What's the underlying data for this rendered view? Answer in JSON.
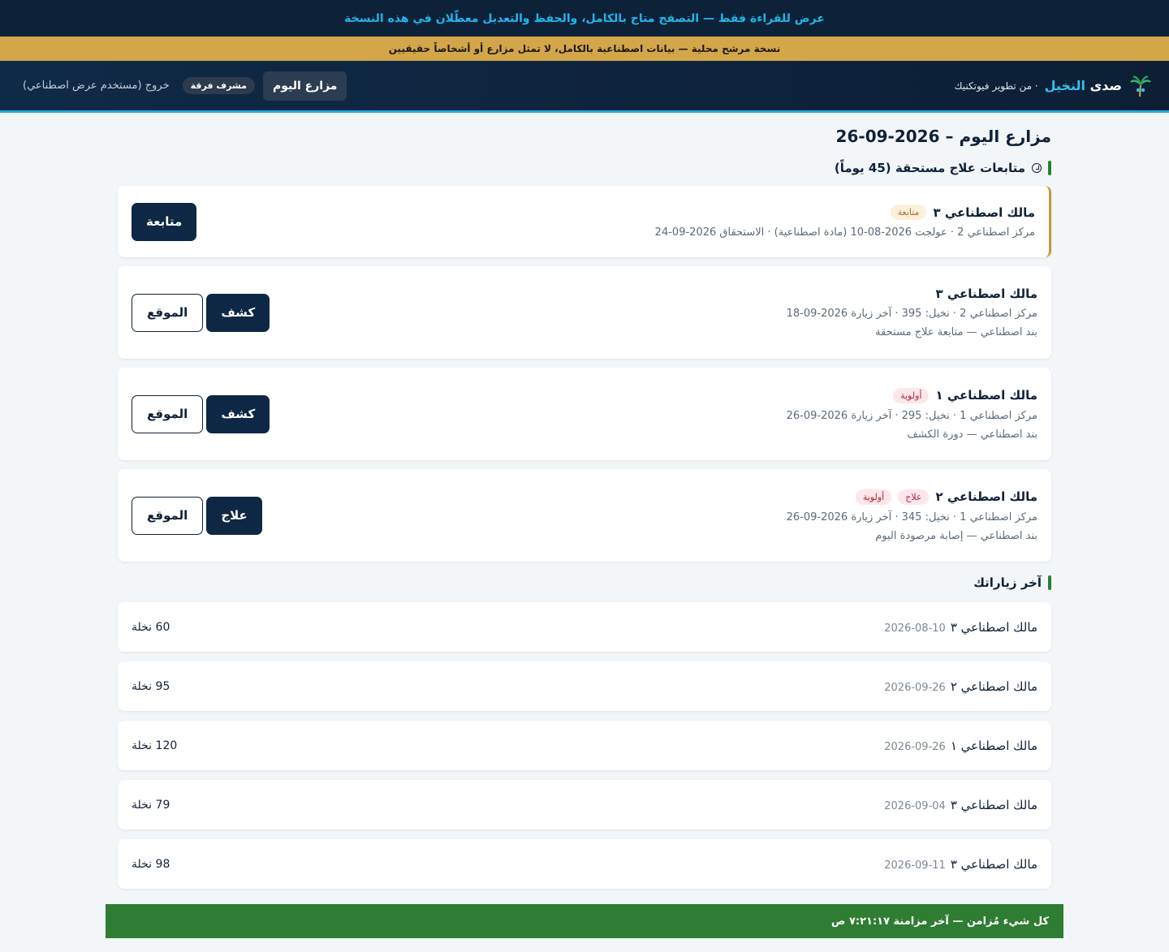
{
  "banners": {
    "readonly": "عرض للقراءة فقط — التصفح متاح بالكامل، والحفظ والتعديل معطّلان في هذه النسخة",
    "demo": "نسخة مرشح محلية — بيانات اصطناعية بالكامل، لا تمثل مزارع أو أشخاصاً حقيقيين"
  },
  "nav": {
    "brand_part1": "صدى",
    "brand_part2": "النخيل",
    "brand_sub": "· من تطوير فيوتكنيك",
    "tab_today": "مزارع اليوم",
    "role": "مشرف فرقة",
    "logout": "خروج (مستخدم عرض اصطناعي)"
  },
  "page": {
    "title": "مزارع اليوم – 2026-09-26",
    "followups_title": "متابعات علاج مستحقة (45 يوماً)",
    "visits_title": "آخر زياراتك"
  },
  "followup": {
    "owner": "مالك اصطناعي ٣",
    "tag": "متابعة",
    "meta": "مركز اصطناعي 2 · عولجت 2026-08-10 (مادة اصطناعية) · الاستحقاق 2026-09-24",
    "button": "متابعة"
  },
  "farms": [
    {
      "owner": "مالك اصطناعي ٣",
      "tags": [],
      "meta": "مركز اصطناعي 2 · نخيل: 395 · آخر زيارة 2026-09-18",
      "reason": "بند اصطناعي — متابعة علاج مستحقة",
      "location": "الموقع",
      "action": "كشف"
    },
    {
      "owner": "مالك اصطناعي ١",
      "tags": [
        "أولوية"
      ],
      "meta": "مركز اصطناعي 1 · نخيل: 295 · آخر زيارة 2026-09-26",
      "reason": "بند اصطناعي — دورة الكشف",
      "location": "الموقع",
      "action": "كشف"
    },
    {
      "owner": "مالك اصطناعي ٢",
      "tags": [
        "علاج",
        "أولوية"
      ],
      "meta": "مركز اصطناعي 1 · نخيل: 345 · آخر زيارة 2026-09-26",
      "reason": "بند اصطناعي — إصابة مرصودة اليوم",
      "location": "الموقع",
      "action": "علاج"
    }
  ],
  "visits": [
    {
      "owner": "مالك اصطناعي ٣",
      "date": "2026-08-10",
      "count": "60 نخلة"
    },
    {
      "owner": "مالك اصطناعي ٢",
      "date": "2026-09-26",
      "count": "95 نخلة"
    },
    {
      "owner": "مالك اصطناعي ١",
      "date": "2026-09-26",
      "count": "120 نخلة"
    },
    {
      "owner": "مالك اصطناعي ٣",
      "date": "2026-09-04",
      "count": "79 نخلة"
    },
    {
      "owner": "مالك اصطناعي ٣",
      "date": "2026-09-11",
      "count": "98 نخلة"
    }
  ],
  "footer": {
    "status": "كل شيء مُزامن — آخر مزامنة ٧:٢١:١٧ ص"
  },
  "colors": {
    "navy": "#0e2744",
    "accent_blue": "#27a9e1",
    "gold": "#d4a64a",
    "green": "#2e7d32"
  }
}
